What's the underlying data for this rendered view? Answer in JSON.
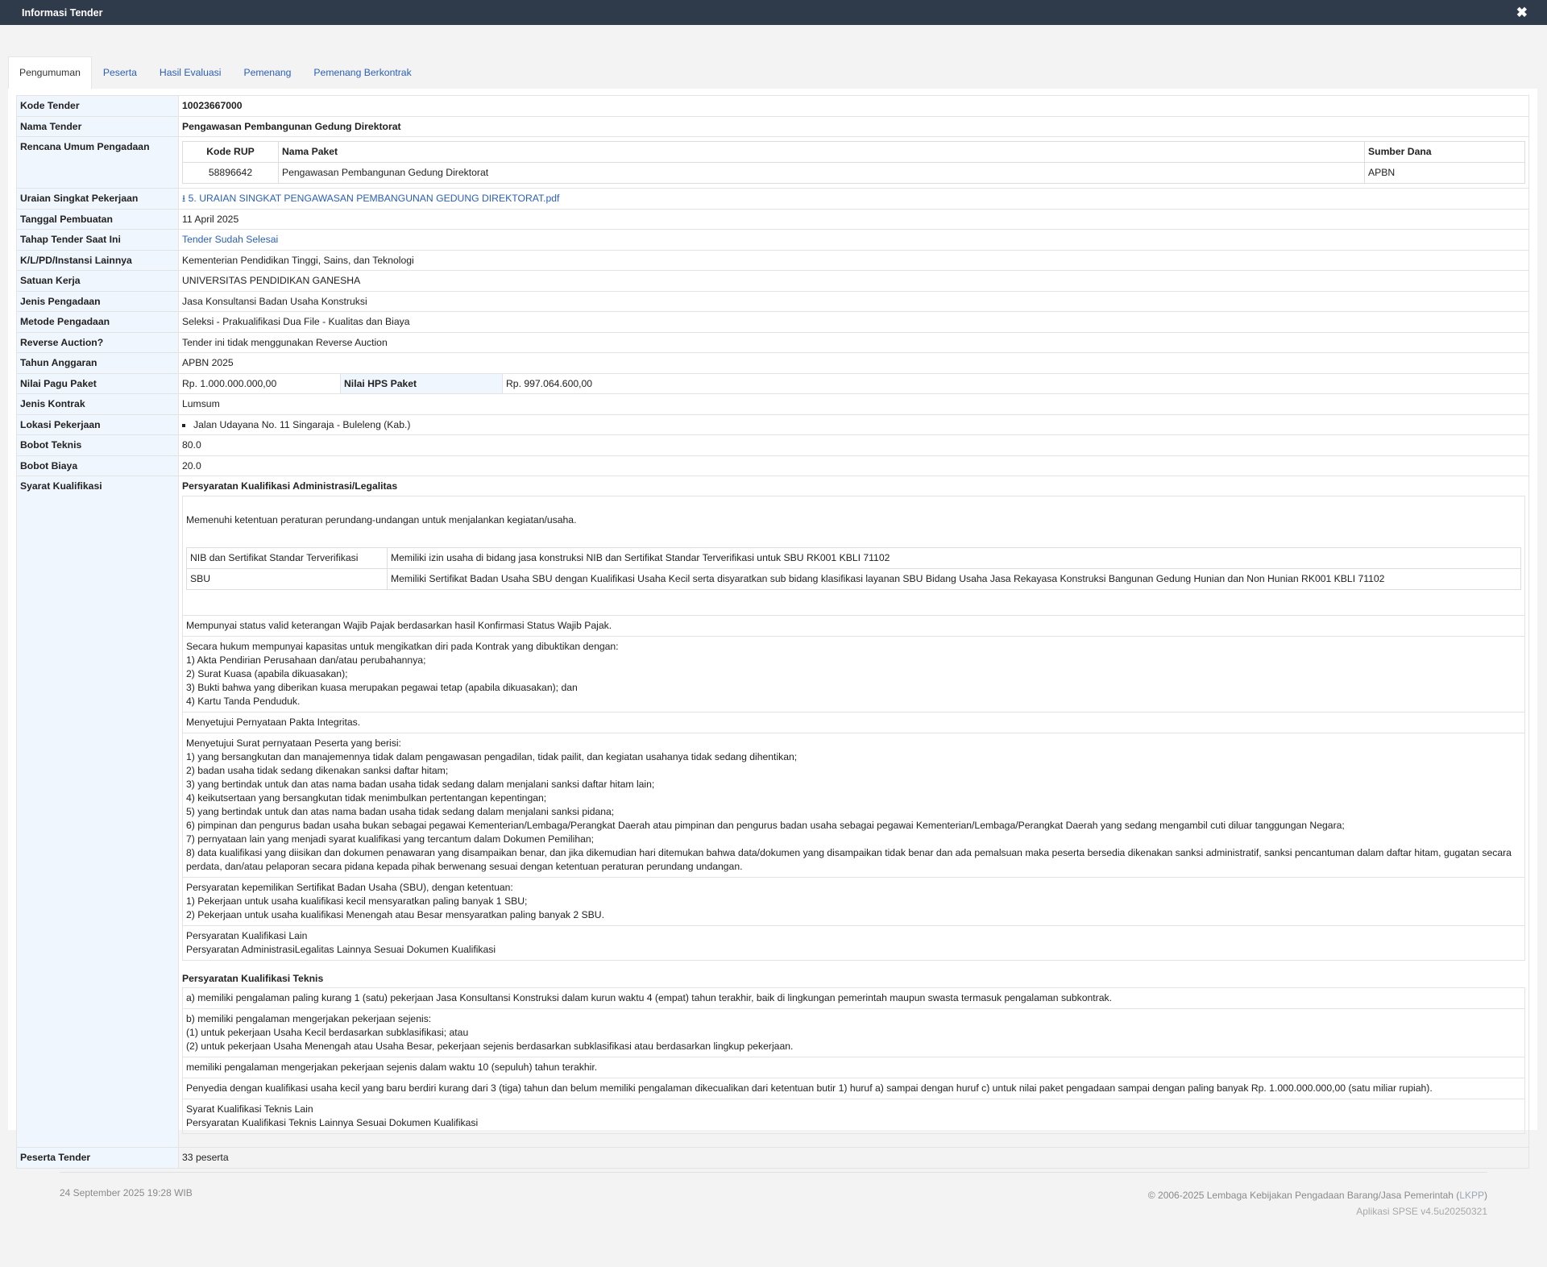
{
  "window": {
    "title": "Informasi Tender",
    "close_icon": "close-icon"
  },
  "tabs": [
    {
      "label": "Pengumuman",
      "active": true
    },
    {
      "label": "Peserta"
    },
    {
      "label": "Hasil Evaluasi"
    },
    {
      "label": "Pemenang"
    },
    {
      "label": "Pemenang Berkontrak"
    }
  ],
  "labels": {
    "kode_tender": "Kode Tender",
    "nama_tender": "Nama Tender",
    "rup": "Rencana Umum Pengadaan",
    "uraian": "Uraian Singkat Pekerjaan",
    "tanggal": "Tanggal Pembuatan",
    "tahap": "Tahap Tender Saat Ini",
    "klpd": "K/L/PD/Instansi Lainnya",
    "satker": "Satuan Kerja",
    "jenis_pengadaan": "Jenis Pengadaan",
    "metode": "Metode Pengadaan",
    "reverse": "Reverse Auction?",
    "tahun": "Tahun Anggaran",
    "pagu": "Nilai Pagu Paket",
    "hps": "Nilai HPS Paket",
    "kontrak": "Jenis Kontrak",
    "lokasi": "Lokasi Pekerjaan",
    "bobot_teknis": "Bobot Teknis",
    "bobot_biaya": "Bobot Biaya",
    "syarat": "Syarat Kualifikasi",
    "peserta": "Peserta Tender"
  },
  "values": {
    "kode_tender": "10023667000",
    "nama_tender": "Pengawasan Pembangunan Gedung Direktorat",
    "uraian_file": "5. URAIAN SINGKAT PENGAWASAN PEMBANGUNAN GEDUNG DIREKTORAT.pdf",
    "tanggal": "11 April 2025",
    "tahap": "Tender Sudah Selesai",
    "klpd": "Kementerian Pendidikan Tinggi, Sains, dan Teknologi",
    "satker": "UNIVERSITAS PENDIDIKAN GANESHA",
    "jenis_pengadaan": "Jasa Konsultansi Badan Usaha Konstruksi",
    "metode": "Seleksi - Prakualifikasi Dua File - Kualitas dan Biaya",
    "reverse": "Tender ini tidak menggunakan Reverse Auction",
    "tahun": "APBN 2025",
    "pagu": "Rp. 1.000.000.000,00",
    "hps": "Rp. 997.064.600,00",
    "kontrak": "Lumsum",
    "lokasi": "Jalan Udayana No. 11 Singaraja - Buleleng (Kab.)",
    "bobot_teknis": "80.0",
    "bobot_biaya": "20.0",
    "peserta": "33 peserta"
  },
  "rup_table": {
    "headers": [
      "Kode RUP",
      "Nama Paket",
      "Sumber Dana"
    ],
    "rows": [
      [
        "58896642",
        "Pengawasan Pembangunan Gedung Direktorat",
        "APBN"
      ]
    ]
  },
  "syarat": {
    "admin_title": "Persyaratan Kualifikasi Administrasi/Legalitas",
    "admin_first": "Memenuhi ketentuan peraturan perundang-undangan untuk menjalankan kegiatan/usaha.",
    "nib_table": [
      [
        "NIB dan Sertifikat Standar Terverifikasi",
        "Memiliki izin usaha di bidang jasa konstruksi NIB dan Sertifikat Standar Terverifikasi untuk SBU RK001 KBLI 71102"
      ],
      [
        "SBU",
        "Memiliki Sertifikat Badan Usaha SBU dengan Kualifikasi Usaha Kecil serta disyaratkan sub bidang klasifikasi layanan SBU Bidang Usaha Jasa Rekayasa Konstruksi Bangunan Gedung Hunian dan Non Hunian RK001 KBLI 71102"
      ]
    ],
    "admin_items": [
      "Mempunyai status valid keterangan Wajib Pajak berdasarkan hasil Konfirmasi Status Wajib Pajak.",
      "Secara hukum mempunyai kapasitas untuk mengikatkan diri pada Kontrak yang dibuktikan dengan:\n1) Akta Pendirian Perusahaan dan/atau perubahannya;\n2) Surat Kuasa (apabila dikuasakan);\n3) Bukti bahwa yang diberikan kuasa merupakan pegawai tetap (apabila dikuasakan); dan\n4) Kartu Tanda Penduduk.",
      "Menyetujui Pernyataan Pakta Integritas.",
      "Menyetujui Surat pernyataan Peserta yang berisi:\n1) yang bersangkutan dan manajemennya tidak dalam pengawasan pengadilan, tidak pailit, dan kegiatan usahanya tidak sedang dihentikan;\n2) badan usaha tidak sedang dikenakan sanksi daftar hitam;\n3) yang bertindak untuk dan atas nama badan usaha tidak sedang dalam menjalani sanksi daftar hitam lain;\n4) keikutsertaan yang bersangkutan tidak menimbulkan pertentangan kepentingan;\n5) yang bertindak untuk dan atas nama badan usaha tidak sedang dalam menjalani sanksi pidana;\n6) pimpinan dan pengurus badan usaha bukan sebagai pegawai Kementerian/Lembaga/Perangkat Daerah atau pimpinan dan pengurus badan usaha sebagai pegawai Kementerian/Lembaga/Perangkat Daerah yang sedang mengambil cuti diluar tanggungan Negara;\n7) pernyataan lain yang menjadi syarat kualifikasi yang tercantum dalam Dokumen Pemilihan;\n8) data kualifikasi yang diisikan dan dokumen penawaran yang disampaikan benar, dan jika dikemudian hari ditemukan bahwa data/dokumen yang disampaikan tidak benar dan ada pemalsuan maka peserta bersedia dikenakan sanksi administratif, sanksi pencantuman dalam daftar hitam, gugatan secara perdata, dan/atau pelaporan secara pidana kepada pihak berwenang sesuai dengan ketentuan peraturan perundang undangan.",
      "Persyaratan kepemilikan Sertifikat Badan Usaha (SBU), dengan ketentuan:\n1) Pekerjaan untuk usaha kualifikasi kecil mensyaratkan paling banyak 1 SBU;\n2) Pekerjaan untuk usaha kualifikasi Menengah atau Besar mensyaratkan paling banyak 2 SBU.",
      "Persyaratan Kualifikasi Lain\nPersyaratan AdministrasiLegalitas Lainnya Sesuai Dokumen Kualifikasi"
    ],
    "teknis_title": "Persyaratan Kualifikasi Teknis",
    "teknis_items": [
      "a) memiliki pengalaman paling kurang 1 (satu) pekerjaan Jasa Konsultansi Konstruksi dalam kurun waktu 4 (empat) tahun terakhir, baik di lingkungan pemerintah maupun swasta termasuk pengalaman subkontrak.",
      "b) memiliki pengalaman mengerjakan pekerjaan sejenis:\n(1) untuk pekerjaan Usaha Kecil berdasarkan subklasifikasi; atau\n(2) untuk pekerjaan Usaha Menengah atau Usaha Besar, pekerjaan sejenis berdasarkan subklasifikasi atau berdasarkan lingkup pekerjaan.",
      "memiliki pengalaman mengerjakan pekerjaan sejenis dalam waktu 10 (sepuluh) tahun terakhir.",
      "Penyedia dengan kualifikasi usaha kecil yang baru berdiri kurang dari 3 (tiga) tahun dan belum memiliki pengalaman dikecualikan dari ketentuan butir 1) huruf a) sampai dengan huruf c) untuk nilai paket pengadaan sampai dengan paling banyak Rp. 1.000.000.000,00 (satu miliar rupiah).",
      "Syarat Kualifikasi Teknis Lain\nPersyaratan Kualifikasi Teknis Lainnya Sesuai Dokumen Kualifikasi"
    ]
  },
  "footer": {
    "timestamp": "24 September 2025 19:28 WIB",
    "copyright_prefix": "© 2006-2025 Lembaga Kebijakan Pengadaan Barang/Jasa Pemerintah (",
    "copyright_abbr": "LKPP",
    "copyright_suffix": ")",
    "app_version": "Aplikasi SPSE v4.5u20250321"
  },
  "colors": {
    "titlebar": "#2f3a4a",
    "link": "#2b5fb8",
    "label_bg": "#f0f6fd"
  }
}
